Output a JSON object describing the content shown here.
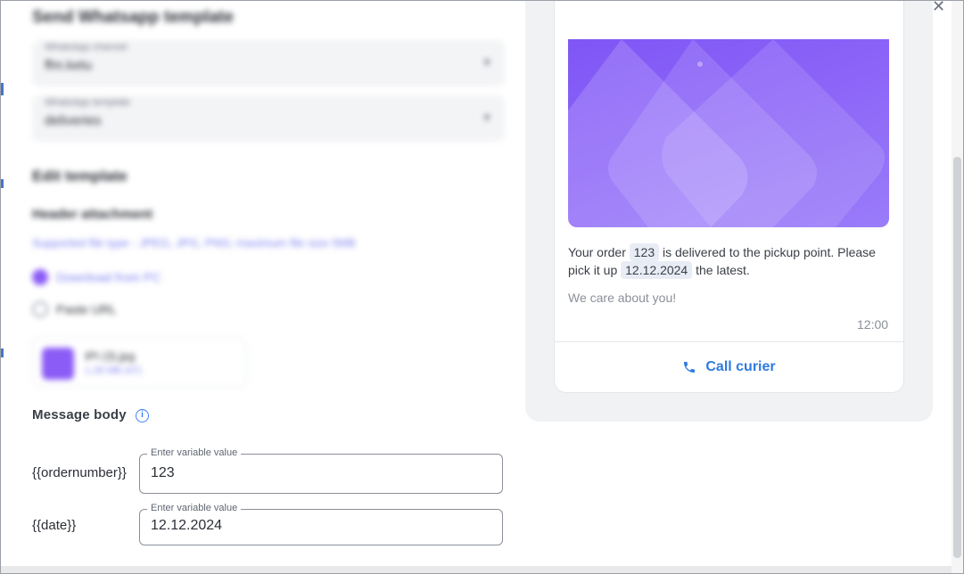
{
  "modal": {
    "title": "Send Whatsapp template",
    "close_icon": "close-icon"
  },
  "selects": [
    {
      "label": "WhatsApp channel",
      "value": "ffm.ketu"
    },
    {
      "label": "WhatsApp template",
      "value": "deliveries"
    }
  ],
  "edit": {
    "title": "Edit template",
    "header_attachment_title": "Header attachment",
    "supported_hint": "Supported file type - JPEG, JPG, PNG; maximum file size 5MB",
    "option_upload": "Download from PC",
    "option_url": "Paste URL",
    "file_name": "IPI (3).jpg",
    "file_size": "1.28 MB (47)"
  },
  "message_body": {
    "title": "Message body",
    "variables": [
      {
        "label": "{{ordernumber}}",
        "legend": "Enter variable value",
        "value": "123"
      },
      {
        "label": "{{date}}",
        "legend": "Enter variable value",
        "value": "12.12.2024"
      }
    ]
  },
  "preview": {
    "text_before_order": "Your order",
    "order_chip": "123",
    "text_after_order": "is delivered to the pickup point. Please pick it up",
    "date_chip": "12.12.2024",
    "text_end": "the latest.",
    "footer": "We care about you!",
    "time": "12:00",
    "button_label": "Call curier",
    "button_icon": "phone-icon"
  },
  "colors": {
    "accent": "#2f7be0",
    "brand_purple": "#8b5cf6",
    "preview_bg": "#f1f2f4"
  }
}
